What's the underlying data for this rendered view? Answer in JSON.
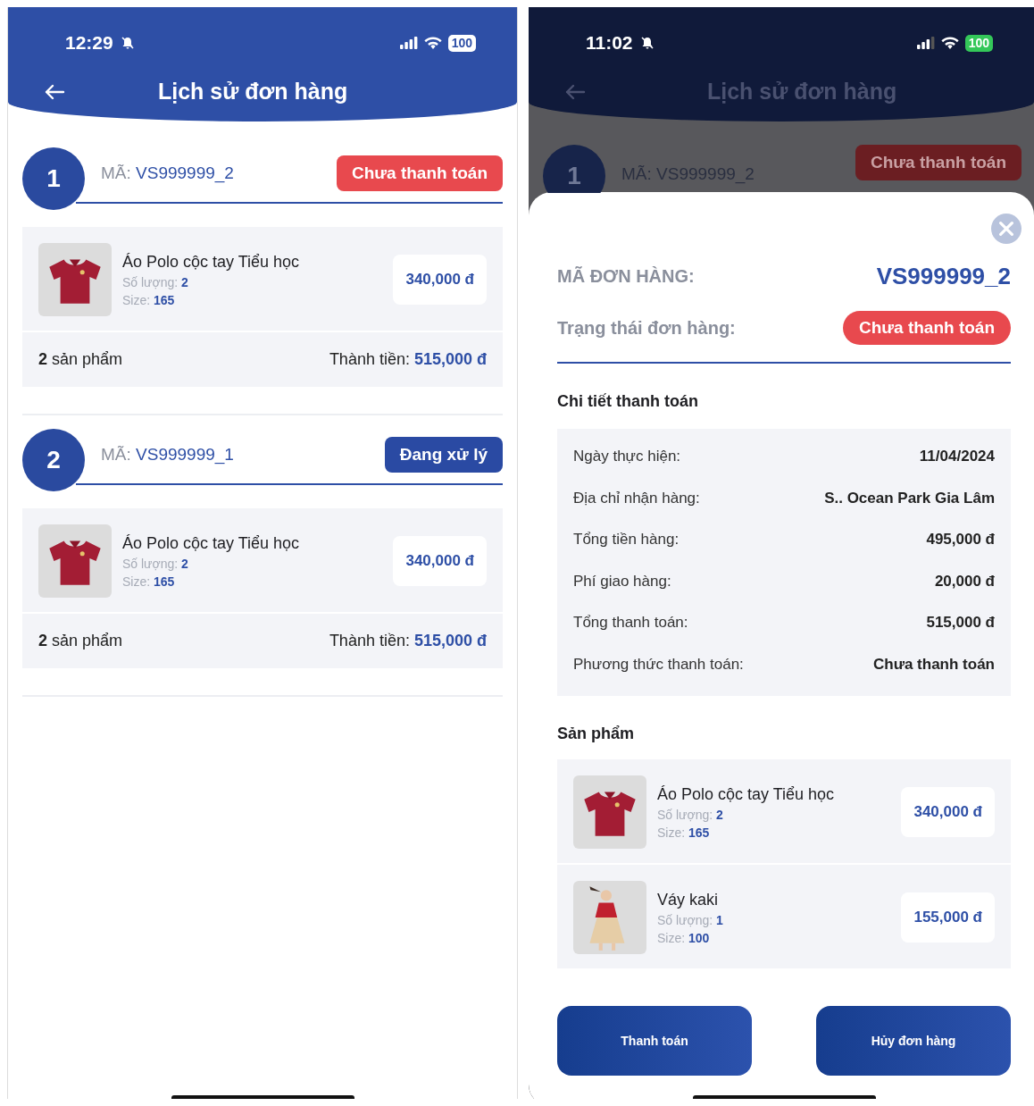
{
  "order_list": {
    "status_bar": {
      "time": "12:29",
      "battery": "100"
    },
    "header": {
      "title": "Lịch sử đơn hàng"
    },
    "orders": [
      {
        "index": "1",
        "code_label": "MÃ:",
        "code": "VS999999_2",
        "status": "Chưa thanh toán",
        "kind": "unpaid",
        "items": [
          {
            "name": "Áo Polo cộc tay Tiểu học",
            "qty_label": "Số lượng:",
            "qty": "2",
            "size_label": "Size:",
            "size": "165",
            "price": "340,000 đ"
          }
        ],
        "count": "2",
        "count_label": "sản phẩm",
        "total_label": "Thành tiền:",
        "total": "515,000 đ"
      },
      {
        "index": "2",
        "code_label": "MÃ:",
        "code": "VS999999_1",
        "status": "Đang xử lý",
        "kind": "processing",
        "items": [
          {
            "name": "Áo Polo cộc tay Tiểu học",
            "qty_label": "Số lượng:",
            "qty": "2",
            "size_label": "Size:",
            "size": "165",
            "price": "340,000 đ"
          }
        ],
        "count": "2",
        "count_label": "sản phẩm",
        "total_label": "Thành tiền:",
        "total": "515,000 đ"
      }
    ]
  },
  "order_detail": {
    "status_bar": {
      "time": "11:02",
      "battery": "100"
    },
    "header": {
      "title": "Lịch sử đơn hàng"
    },
    "background_order": {
      "index": "1",
      "code_label": "MÃ:",
      "code": "VS999999_2",
      "status": "Chưa thanh toán"
    },
    "sheet": {
      "code_label": "MÃ ĐƠN HÀNG:",
      "code": "VS999999_2",
      "status_label": "Trạng thái đơn hàng:",
      "status": "Chưa thanh toán",
      "payment_title": "Chi tiết thanh toán",
      "payment_rows": [
        {
          "label": "Ngày thực hiện:",
          "value": "11/04/2024"
        },
        {
          "label": "Địa chỉ nhận hàng:",
          "value": "S.. Ocean Park Gia Lâm"
        },
        {
          "label": "Tổng tiền hàng:",
          "value": "495,000 đ"
        },
        {
          "label": "Phí giao hàng:",
          "value": "20,000 đ"
        },
        {
          "label": "Tổng thanh toán:",
          "value": "515,000 đ"
        },
        {
          "label": "Phương thức thanh toán:",
          "value": "Chưa thanh toán"
        }
      ],
      "products_title": "Sản phẩm",
      "items": [
        {
          "name": "Áo Polo cộc tay Tiểu học",
          "qty_label": "Số lượng:",
          "qty": "2",
          "size_label": "Size:",
          "size": "165",
          "price": "340,000 đ"
        },
        {
          "name": "Váy kaki",
          "qty_label": "Số lượng:",
          "qty": "1",
          "size_label": "Size:",
          "size": "100",
          "price": "155,000 đ"
        }
      ],
      "buttons": [
        "Thanh toán",
        "Hủy đơn hàng"
      ]
    }
  }
}
